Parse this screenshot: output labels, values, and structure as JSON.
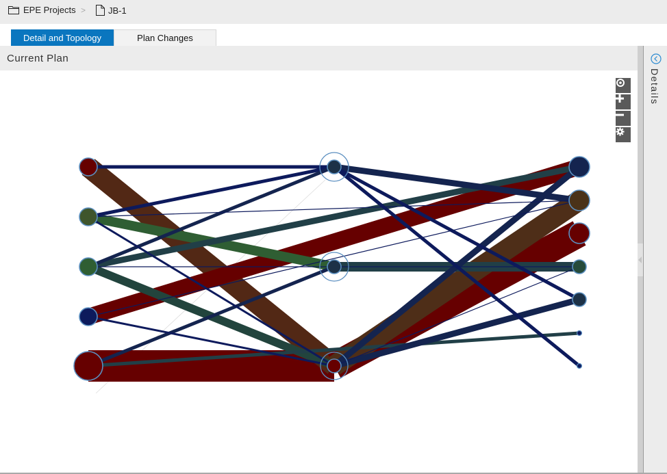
{
  "breadcrumb": {
    "items": [
      {
        "label": "EPE Projects",
        "icon": "folder-icon"
      },
      {
        "label": "JB-1",
        "icon": "document-icon"
      }
    ],
    "separator": ">"
  },
  "tabs": [
    {
      "label": "Detail and Topology",
      "active": true
    },
    {
      "label": "Plan Changes",
      "active": false
    }
  ],
  "panel": {
    "title": "Current Plan"
  },
  "graph_controls": [
    {
      "name": "fit-view",
      "icon": "target-icon"
    },
    {
      "name": "zoom-in",
      "icon": "plus-icon"
    },
    {
      "name": "zoom-out",
      "icon": "minus-icon"
    },
    {
      "name": "settings",
      "icon": "gear-icon"
    }
  ],
  "side_panel": {
    "label": "Details",
    "toggle_icon": "chevron-left-circle-icon"
  },
  "colors": {
    "tab_active": "#0a76bf",
    "node_stroke": "#5b8fc0",
    "dark_red": "#660000",
    "brown": "#522815",
    "navy": "#0d1a5c",
    "dark_navy": "#14244f",
    "slate": "#213f47",
    "green": "#2f5e33",
    "olive_green": "#3f552c"
  },
  "topology": {
    "nodes": [
      {
        "id": "L1",
        "color": "#660000",
        "size": 2
      },
      {
        "id": "L2",
        "color": "#3f552c",
        "size": 2
      },
      {
        "id": "L3",
        "color": "#2f5e33",
        "size": 2
      },
      {
        "id": "L4",
        "color": "#0d1a5c",
        "size": 2
      },
      {
        "id": "L5",
        "color": "#660000",
        "size": 4
      },
      {
        "id": "M1",
        "color": "#1c3147",
        "size": 1,
        "ring": true
      },
      {
        "id": "M2",
        "color": "#1c3147",
        "size": 1,
        "ring": true
      },
      {
        "id": "M3",
        "color": "#660000",
        "size": 7,
        "ring": true
      },
      {
        "id": "R1",
        "color": "#14244f",
        "size": 3
      },
      {
        "id": "R2",
        "color": "#4a3218",
        "size": 3
      },
      {
        "id": "R3",
        "color": "#660000",
        "size": 3
      },
      {
        "id": "R4",
        "color": "#264b3b",
        "size": 1
      },
      {
        "id": "R5",
        "color": "#1c3147",
        "size": 1
      },
      {
        "id": "R6",
        "color": "#0d1a5c",
        "size": 0
      },
      {
        "id": "R7",
        "color": "#0d1a5c",
        "size": 0
      }
    ],
    "links": [
      {
        "from": "L5",
        "to": "M3",
        "color": "#660000",
        "weight": 12
      },
      {
        "from": "L1",
        "to": "M3",
        "color": "#522815",
        "weight": 8
      },
      {
        "from": "M3",
        "to": "R3",
        "color": "#660000",
        "weight": 10
      },
      {
        "from": "M3",
        "to": "R2",
        "color": "#4e2e18",
        "weight": 8
      },
      {
        "from": "L4",
        "to": "R1",
        "color": "#660000",
        "weight": 7
      },
      {
        "from": "L2",
        "to": "M2",
        "color": "#2f5e33",
        "weight": 5
      },
      {
        "from": "L3",
        "to": "M3",
        "color": "#22443d",
        "weight": 4
      },
      {
        "from": "M2",
        "to": "R4",
        "color": "#213f47",
        "weight": 5
      },
      {
        "from": "L3",
        "to": "R1",
        "color": "#213f47",
        "weight": 3
      },
      {
        "from": "L5",
        "to": "R6",
        "color": "#213f47",
        "weight": 2
      },
      {
        "from": "M3",
        "to": "R1",
        "color": "#14244f",
        "weight": 3
      },
      {
        "from": "M3",
        "to": "R5",
        "color": "#14244f",
        "weight": 3
      },
      {
        "from": "M1",
        "to": "R2",
        "color": "#14244f",
        "weight": 3
      },
      {
        "from": "L1",
        "to": "M1",
        "color": "#0d1a5c",
        "weight": 2
      },
      {
        "from": "L2",
        "to": "M1",
        "color": "#0d1a5c",
        "weight": 2
      },
      {
        "from": "L3",
        "to": "M1",
        "color": "#14244f",
        "weight": 2
      },
      {
        "from": "M1",
        "to": "R5",
        "color": "#0d1a5c",
        "weight": 2
      },
      {
        "from": "M1",
        "to": "R7",
        "color": "#0d1a5c",
        "weight": 2
      },
      {
        "from": "L5",
        "to": "M2",
        "color": "#14244f",
        "weight": 2
      },
      {
        "from": "L4",
        "to": "M3",
        "color": "#0d1a5c",
        "weight": 1
      },
      {
        "from": "L2",
        "to": "M3",
        "color": "#0d1a5c",
        "weight": 1
      },
      {
        "from": "L2",
        "to": "R2",
        "color": "#0d1a5c",
        "weight": 0.5
      },
      {
        "from": "L3",
        "to": "R4",
        "color": "#0d1a5c",
        "weight": 0.5
      },
      {
        "from": "L4",
        "to": "R2",
        "color": "#0d1a5c",
        "weight": 0.5
      },
      {
        "from": "M3",
        "to": "R4",
        "color": "#0d1a5c",
        "weight": 0.5
      }
    ]
  }
}
